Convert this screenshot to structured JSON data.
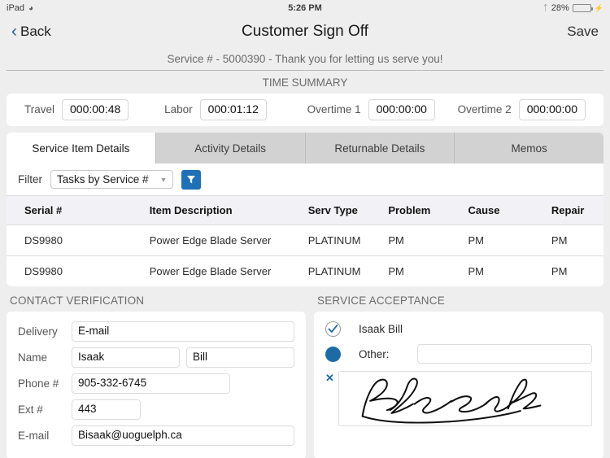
{
  "statusbar": {
    "device": "iPad",
    "wifi_icon": "wifi-icon",
    "time": "5:26 PM",
    "bluetooth_icon": "bluetooth-icon",
    "battery_percent": "28%",
    "battery_level": 28,
    "charging_icon": "charging-bolt-icon"
  },
  "navbar": {
    "back_label": "Back",
    "back_icon": "chevron-left-icon",
    "title": "Customer Sign Off",
    "save_label": "Save"
  },
  "banner": {
    "text": "Service # - 5000390 - Thank you for letting us serve you!"
  },
  "time_summary": {
    "title": "TIME SUMMARY",
    "fields": [
      {
        "label": "Travel",
        "value": "000:00:48"
      },
      {
        "label": "Labor",
        "value": "000:01:12"
      },
      {
        "label": "Overtime 1",
        "value": "000:00:00"
      },
      {
        "label": "Overtime 2",
        "value": "000:00:00"
      }
    ]
  },
  "tabs": [
    {
      "label": "Service Item Details",
      "active": true
    },
    {
      "label": "Activity Details",
      "active": false
    },
    {
      "label": "Returnable Details",
      "active": false
    },
    {
      "label": "Memos",
      "active": false
    }
  ],
  "filter": {
    "label": "Filter",
    "selected": "Tasks by Service #",
    "caret_icon": "chevron-down-icon",
    "button_icon": "funnel-icon",
    "button_color": "#1f70b4"
  },
  "table": {
    "headers": [
      "Serial #",
      "Item Description",
      "Serv Type",
      "Problem",
      "Cause",
      "Repair"
    ],
    "rows": [
      {
        "serial": "DS9980",
        "description": "Power Edge Blade Server",
        "serv_type": "PLATINUM",
        "problem": "PM",
        "cause": "PM",
        "repair": "PM"
      },
      {
        "serial": "DS9980",
        "description": "Power Edge Blade Server",
        "serv_type": "PLATINUM",
        "problem": "PM",
        "cause": "PM",
        "repair": "PM"
      }
    ]
  },
  "contact_verification": {
    "title": "CONTACT VERIFICATION",
    "delivery_label": "Delivery",
    "delivery_value": "E-mail",
    "name_label": "Name",
    "first_name": "Isaak",
    "last_name": "Bill",
    "phone_label": "Phone #",
    "phone_value": "905-332-6745",
    "ext_label": "Ext #",
    "ext_value": "443",
    "email_label": "E-mail",
    "email_value": "Bisaak@uoguelph.ca"
  },
  "service_acceptance": {
    "title": "SERVICE ACCEPTANCE",
    "option_person_label": "Isaak Bill",
    "option_person_icon": "check-icon",
    "option_person_selected": true,
    "option_other_label": "Other:",
    "option_other_value": "",
    "option_other_selected": false,
    "accent_color": "#1d6ba4",
    "signature_clear_icon": "close-x-icon",
    "signature_clear_label": "✕",
    "signature_alt": "handwritten-signature"
  }
}
